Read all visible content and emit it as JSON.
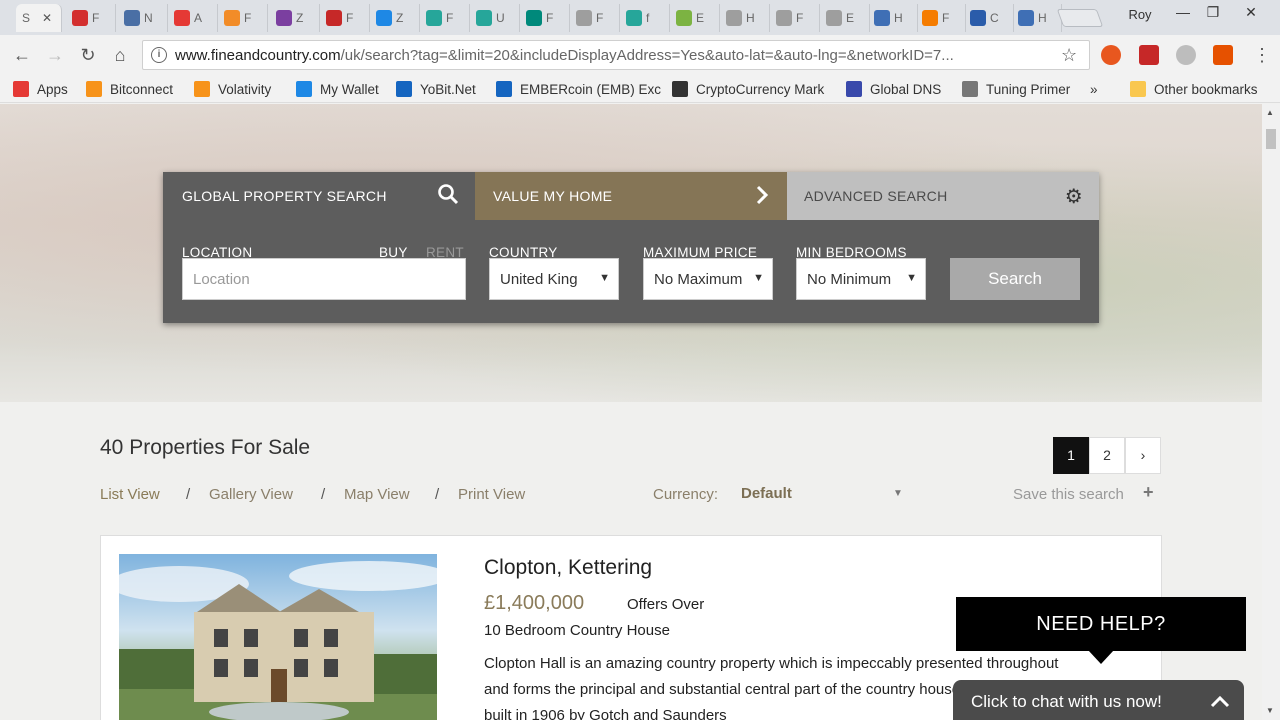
{
  "browser": {
    "tabs": [
      {
        "label": "S",
        "color": "#ffffff",
        "active": true
      },
      {
        "label": "F",
        "color": "#d32f2f"
      },
      {
        "label": "N",
        "color": "#4a6fa5"
      },
      {
        "label": "A",
        "color": "#e53935"
      },
      {
        "label": "F",
        "color": "#f28c28"
      },
      {
        "label": "Z",
        "color": "#7b3fa0"
      },
      {
        "label": "F",
        "color": "#c62828"
      },
      {
        "label": "Z",
        "color": "#1e88e5"
      },
      {
        "label": "F",
        "color": "#26a69a"
      },
      {
        "label": "U",
        "color": "#26a69a"
      },
      {
        "label": "F",
        "color": "#00897b"
      },
      {
        "label": "F",
        "color": "#9e9e9e"
      },
      {
        "label": "f",
        "color": "#26a69a"
      },
      {
        "label": "E",
        "color": "#7cb342"
      },
      {
        "label": "H",
        "color": "#9e9e9e"
      },
      {
        "label": "F",
        "color": "#9e9e9e"
      },
      {
        "label": "E",
        "color": "#9e9e9e"
      },
      {
        "label": "H",
        "color": "#3f6fb5"
      },
      {
        "label": "F",
        "color": "#f57c00"
      },
      {
        "label": "C",
        "color": "#2a5caa"
      },
      {
        "label": "H",
        "color": "#3f6fb5"
      }
    ],
    "profile": "Roy",
    "url_host": "www.fineandcountry.com",
    "url_path": "/uk/search?tag=&limit=20&includeDisplayAddress=Yes&auto-lat=&auto-lng=&networkID=7..."
  },
  "bookmarks": [
    {
      "label": "Apps",
      "icon": "apps-icon",
      "color": "#e53935"
    },
    {
      "label": "Bitconnect",
      "icon": "bitconnect-icon",
      "color": "#f7931a"
    },
    {
      "label": "Volativity",
      "icon": "volativity-icon",
      "color": "#f7931a"
    },
    {
      "label": "My Wallet",
      "icon": "wallet-icon",
      "color": "#1e88e5"
    },
    {
      "label": "YoBit.Net",
      "icon": "yobit-icon",
      "color": "#1565c0"
    },
    {
      "label": "EMBERcoin (EMB) Exc",
      "icon": "yobit-icon",
      "color": "#1565c0"
    },
    {
      "label": "CryptoCurrency Mark",
      "icon": "dollar-icon",
      "color": "#333333"
    },
    {
      "label": "Global DNS",
      "icon": "globe-icon",
      "color": "#3949ab"
    },
    {
      "label": "Tuning Primer",
      "icon": "page-icon",
      "color": "#777777"
    },
    {
      "label": "»",
      "icon": "",
      "color": ""
    },
    {
      "label": "Other bookmarks",
      "icon": "folder-icon",
      "color": "#f9c74f"
    }
  ],
  "search": {
    "tabs": [
      "GLOBAL PROPERTY SEARCH",
      "VALUE MY HOME",
      "ADVANCED SEARCH"
    ],
    "location_label": "LOCATION",
    "buy": "BUY",
    "rent": "RENT",
    "location_placeholder": "Location",
    "country_label": "COUNTRY",
    "country_value": "United King",
    "price_label": "MAXIMUM PRICE",
    "price_value": "No Maximum",
    "bedrooms_label": "MIN BEDROOMS",
    "bedrooms_value": "No Minimum",
    "button": "Search",
    "colors": {
      "panel": "#5d5d5d",
      "value_tab": "#857556",
      "advanced_tab": "#bfbfbf"
    }
  },
  "results": {
    "count": "40 Properties For Sale",
    "pages": [
      "1",
      "2",
      "›"
    ],
    "views": [
      "List View",
      "Gallery View",
      "Map View",
      "Print View"
    ],
    "currency_label": "Currency:",
    "currency_value": "Default",
    "save_search": "Save this search",
    "save_icon": "plus-icon"
  },
  "property": {
    "title": "Clopton, Kettering",
    "price": "£1,400,000",
    "offer": "Offers Over",
    "type": "10 Bedroom Country House",
    "description": "Clopton Hall is an amazing country property which is impeccably presented throughout and forms the principal and substantial central part of the country house. The house was built in 1906 by Gotch and Saunders"
  },
  "help": {
    "title": "NEED HELP?",
    "chat": "Click to chat with us now!"
  }
}
